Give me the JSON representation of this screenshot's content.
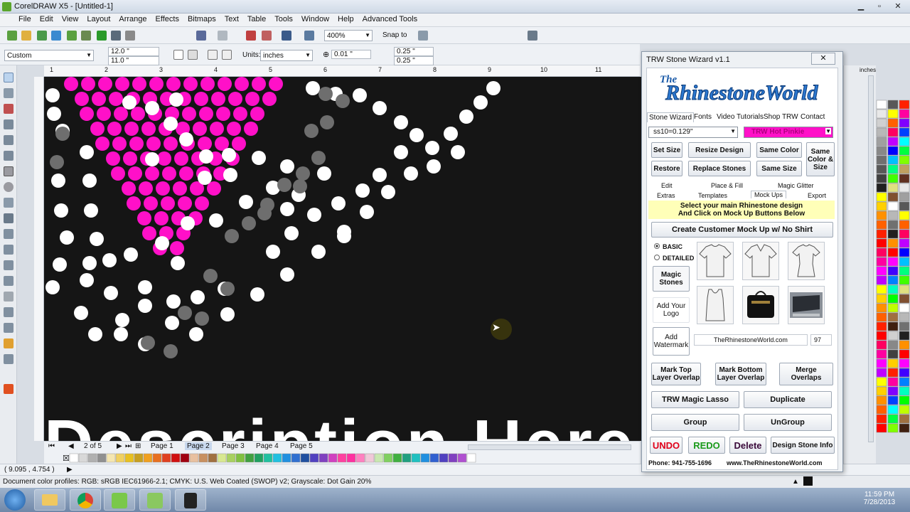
{
  "window": {
    "title": "CorelDRAW X5 - [Untitled-1]"
  },
  "menu": [
    "File",
    "Edit",
    "View",
    "Layout",
    "Arrange",
    "Effects",
    "Bitmaps",
    "Text",
    "Table",
    "Tools",
    "Window",
    "Help",
    "Advanced Tools"
  ],
  "toolbar": {
    "zoom": "400%",
    "snap_to": "Snap to"
  },
  "propbar": {
    "page_preset": "Custom",
    "width": "12.0 \"",
    "height": "11.0 \"",
    "units_label": "Units:",
    "units": "inches",
    "nudge": "0.01 \"",
    "dup_x": "0.25 \"",
    "dup_y": "0.25 \""
  },
  "ruler": {
    "labels": [
      "1",
      "2",
      "3",
      "4",
      "5",
      "6",
      "7",
      "8",
      "9",
      "10",
      "11"
    ],
    "units": "inches"
  },
  "canvas": {
    "big_text": "Description Here!"
  },
  "pages": {
    "counter": "2 of 5",
    "tabs": [
      "Page 1",
      "Page 2",
      "Page 3",
      "Page 4",
      "Page 5"
    ],
    "active": "Page 2"
  },
  "status": {
    "coords": "( 9.095 , 4.754 )",
    "profile": "Document color profiles: RGB: sRGB IEC61966-2.1; CMYK: U.S. Web Coated (SWOP) v2; Grayscale: Dot Gain 20%"
  },
  "clock": {
    "time": "11:59 PM",
    "date": "7/28/2013"
  },
  "wizard": {
    "title": "TRW Stone Wizard v1.1",
    "close": "✕",
    "logo_top": "The",
    "logo_main": "RhinestoneWorld",
    "nav": [
      "Stone Wizard",
      "Fonts",
      "Video Tutorials",
      "Shop TRW",
      "Contact"
    ],
    "size_select": "ss10=0.129\"",
    "color_select": "TRW Hot Pinkie",
    "btn_set_size": "Set Size",
    "btn_resize": "Resize Design",
    "btn_same_color": "Same Color",
    "btn_same_color_size": "Same Color & Size",
    "btn_restore": "Restore",
    "btn_replace": "Replace Stones",
    "btn_same_size": "Same Size",
    "tabs_row1": [
      "Edit",
      "Place & Fill",
      "Magic Glitter"
    ],
    "tabs_row2": [
      "Extras",
      "Templates",
      "Mock Ups",
      "Export"
    ],
    "notice_line1": "Select your main Rhinestone design",
    "notice_line2": "And Click on Mock Up Buttons Below",
    "btn_mockup": "Create Customer Mock Up w/ No Shirt",
    "radio_basic": "BASIC",
    "radio_detailed": "DETAILED",
    "btn_magic_stones": "Magic Stones",
    "btn_add_logo": "Add Your Logo",
    "btn_add_watermark": "Add Watermark",
    "watermark_text": "TheRhinestoneWorld.com",
    "watermark_opacity": "97",
    "btn_mark_top": "Mark Top Layer Overlap",
    "btn_mark_bottom": "Mark Bottom Layer Overlap",
    "btn_merge": "Merge Overlaps",
    "btn_lasso": "TRW Magic Lasso",
    "btn_duplicate": "Duplicate",
    "btn_group": "Group",
    "btn_ungroup": "UnGroup",
    "btn_undo": "UNDO",
    "btn_redo": "REDO",
    "btn_delete": "Delete",
    "btn_design_info": "Design Stone Info",
    "footer_phone": "Phone: 941-755-1696",
    "footer_site": "www.TheRhinestoneWorld.com"
  },
  "colors": {
    "pink": "#ff10c8",
    "white_stone": "#ffffff",
    "gray_stone": "#6e6e6e",
    "canvas_bg": "#151515",
    "undo": "#e0001a",
    "redo": "#1a9a1a"
  }
}
